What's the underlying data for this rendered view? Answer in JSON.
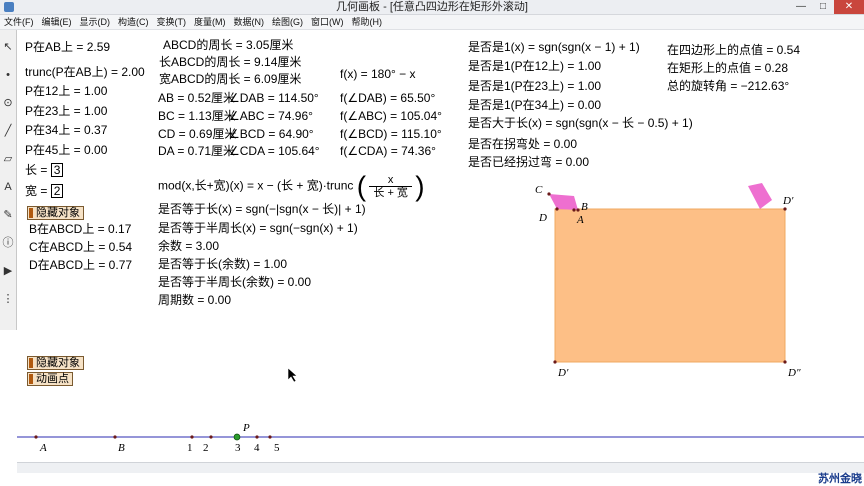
{
  "window": {
    "title": "几何画板 - [任意凸四边形在矩形外滚动]",
    "minimize": "—",
    "maximize": "□",
    "close": "✕"
  },
  "menu": [
    "文件(F)",
    "编辑(E)",
    "显示(D)",
    "构造(C)",
    "变换(T)",
    "度量(M)",
    "数据(N)",
    "绘图(G)",
    "窗口(W)",
    "帮助(H)"
  ],
  "toolbar": [
    "arrow-tool",
    "point-tool",
    "compass-tool",
    "line-tool",
    "text-tool",
    "marker-tool",
    "info-tool",
    "custom-tool"
  ],
  "left_panel": {
    "p_on_ab": "P在AB上 = 2.59",
    "trunc_p_on_ab": "trunc(P在AB上) = 2.00",
    "p_on_12": "P在12上 = 1.00",
    "p_on_23": "P在23上 = 1.00",
    "p_on_34": "P在34上 = 0.37",
    "p_on_45": "P在45上 = 0.00",
    "length_label": "长 =",
    "length_value": "3",
    "width_label": "宽 =",
    "width_value": "2",
    "hide_objects_1": "隐藏对象",
    "b_on_abcd": "B在ABCD上 = 0.17",
    "c_on_abcd": "C在ABCD上 = 0.54",
    "d_on_abcd": "D在ABCD上 = 0.77",
    "hide_objects_2": "隐藏对象",
    "animate_point": "动画点"
  },
  "middle_panel": {
    "perimeter": "ABCD的周长 = 3.05厘米",
    "long_perimeter": "长ABCD的周长 = 9.14厘米",
    "wide_perimeter": "宽ABCD的周长 = 6.09厘米",
    "sides": [
      {
        "len": "AB = 0.52厘米",
        "ang": "∠DAB = 114.50°"
      },
      {
        "len": "BC = 1.13厘米",
        "ang": "∠ABC = 74.96°"
      },
      {
        "len": "CD = 0.69厘米",
        "ang": "∠BCD = 64.90°"
      },
      {
        "len": "DA = 0.71厘米",
        "ang": "∠CDA = 105.64°"
      }
    ],
    "fx_def": "f(x) = 180° − x",
    "fx_values": [
      "f(∠DAB) = 65.50°",
      "f(∠ABC) = 105.04°",
      "f(∠BCD) = 115.10°",
      "f(∠CDA) = 74.36°"
    ],
    "mod_lhs": "mod(x,长+宽)(x) = x − (长 + 宽)·trunc",
    "mod_num": "x",
    "mod_den": "长 + 宽",
    "eq_long": "是否等于长(x) = sgn(−|sgn(x − 长)| + 1)",
    "eq_half": "是否等于半周长(x) = sgn(−sgn(x) + 1)",
    "remainder": "余数 = 3.00",
    "eq_long_rem": "是否等于长(余数) = 1.00",
    "eq_half_rem": "是否等于半周长(余数) = 0.00",
    "period": "周期数 = 0.00"
  },
  "right_panel": {
    "is_one": "是否是1(x) = sgn(sgn(x − 1) + 1)",
    "is_one_12": "是否是1(P在12上) = 1.00",
    "is_one_23": "是否是1(P在23上) = 1.00",
    "is_one_34": "是否是1(P在34上) = 0.00",
    "gt_long": "是否大于长(x) = sgn(sgn(x − 长 − 0.5) + 1)",
    "at_corner": "是否在拐弯处 = 0.00",
    "passed_corner": "是否已经拐过弯 = 0.00",
    "quad_point": "在四边形上的点值 = 0.54",
    "rect_point": "在矩形上的点值 = 0.28",
    "total_rotation": "总的旋转角 = −212.63°"
  },
  "figure_labels": {
    "C": "C",
    "B": "B",
    "D": "D",
    "A": "A",
    "D_prime_top": "D′",
    "D_prime_bottom": "D′",
    "D_double_prime": "D″"
  },
  "track_labels": [
    "A",
    "B",
    "1",
    "2",
    "P",
    "3",
    "4",
    "5"
  ],
  "colors": {
    "rect_fill": "#fdbf86",
    "quad_fill": "#ee6fd0",
    "track_line": "#2b2bb0",
    "point_green": "#2c9c2c",
    "button_fill": "#f6e2c6"
  },
  "watermark": "苏州金晓"
}
